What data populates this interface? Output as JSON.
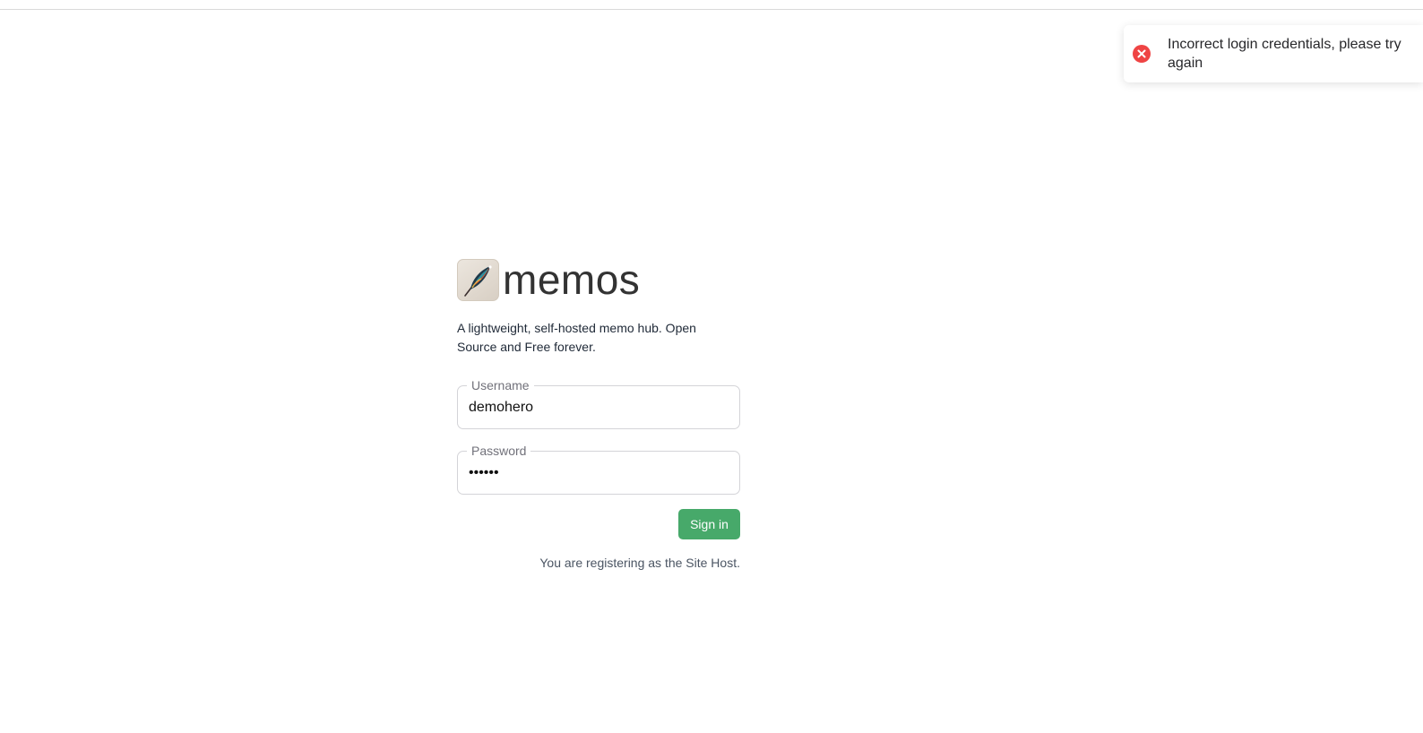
{
  "toast": {
    "message": "Incorrect login credentials, please try again",
    "icon": "error-circle-icon",
    "icon_color": "#ef4444"
  },
  "brand": {
    "name": "memos",
    "logo_icon": "feather-quill-icon",
    "tagline": "A lightweight, self-hosted memo hub. Open Source and Free forever."
  },
  "form": {
    "username_label": "Username",
    "username_value": "demohero",
    "password_label": "Password",
    "password_value": "••••••",
    "signin_label": "Sign in",
    "note": "You are registering as the Site Host."
  },
  "colors": {
    "accent": "#47a96a",
    "error": "#ef4444"
  }
}
